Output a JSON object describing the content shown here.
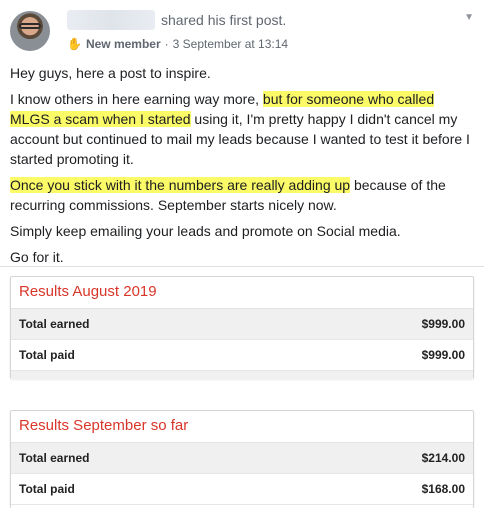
{
  "post": {
    "shared_text": "shared his first post.",
    "badge": "New member",
    "separator": "·",
    "date": "3 September at 13:14",
    "paragraphs": {
      "p1": "Hey guys, here a post to inspire.",
      "p2_a": "I know others in here earning way more, ",
      "p2_hl": "but for someone who called MLGS a scam when I started",
      "p2_b": " using it, I'm pretty happy I didn't cancel my account but continued to mail my leads because I wanted to test it before I started promoting it.",
      "p3_hl": "Once you stick with it the numbers are really adding up",
      "p3_b": " because of the recurring commissions. September starts nicely now.",
      "p4": "Simply keep emailing your leads and promote on Social media.",
      "p5": "Go for it."
    }
  },
  "cards": [
    {
      "title": "Results August 2019",
      "rows": [
        {
          "label": "Total earned",
          "value": "$999.00"
        },
        {
          "label": "Total paid",
          "value": "$999.00"
        }
      ]
    },
    {
      "title": "Results September so far",
      "rows": [
        {
          "label": "Total earned",
          "value": "$214.00"
        },
        {
          "label": "Total paid",
          "value": "$168.00"
        }
      ]
    }
  ],
  "colors": {
    "highlight": "#fbfa67",
    "card_title": "#d9362a"
  },
  "icons": {
    "badge_icon": "wave-hand-icon",
    "menu_icon": "chevron-down-icon"
  }
}
